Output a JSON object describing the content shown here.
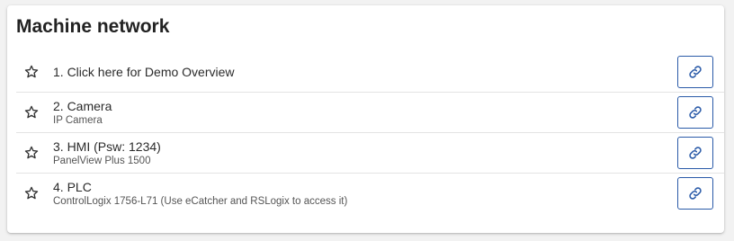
{
  "card": {
    "title": "Machine network"
  },
  "colors": {
    "accent": "#2a5aa8",
    "divider": "#e3e3e3",
    "text": "#2b2b2b"
  },
  "icons": {
    "favorite": "star-outline-icon",
    "open": "link-icon"
  },
  "items": [
    {
      "primary": "1. Click here for Demo Overview",
      "secondary": ""
    },
    {
      "primary": "2. Camera",
      "secondary": "IP Camera"
    },
    {
      "primary": "3. HMI (Psw: 1234)",
      "secondary": "PanelView Plus 1500"
    },
    {
      "primary": "4. PLC",
      "secondary": "ControlLogix 1756-L71 (Use eCatcher and RSLogix to access it)"
    }
  ]
}
